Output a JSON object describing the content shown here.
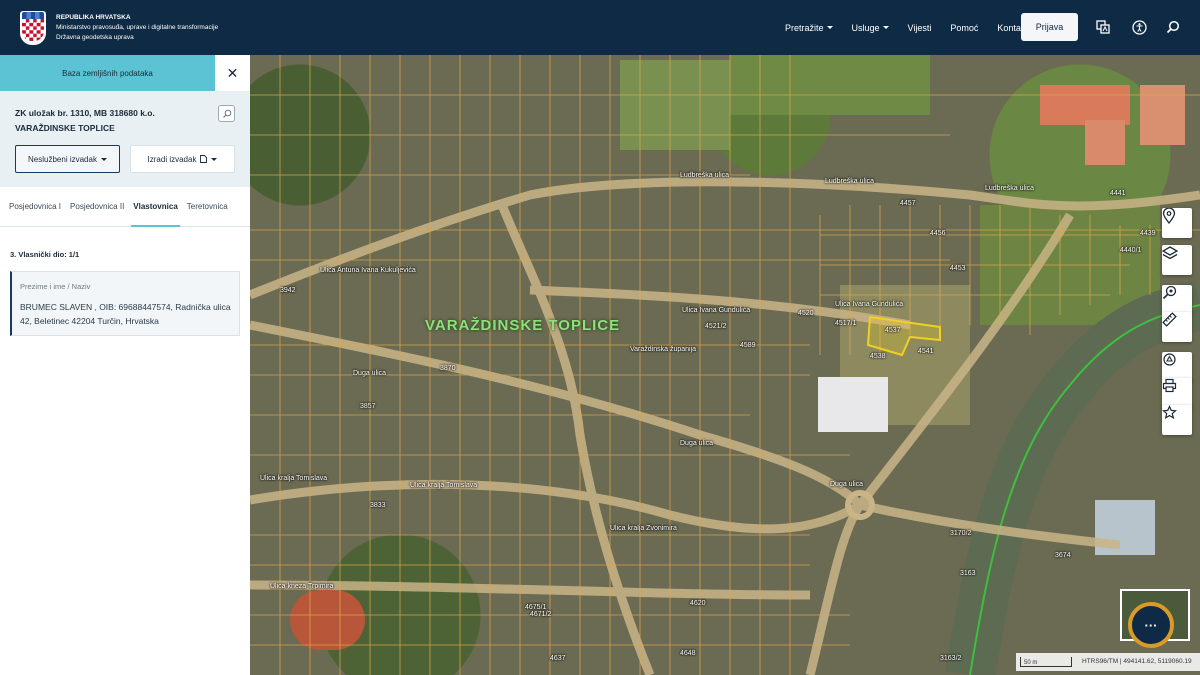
{
  "header": {
    "org_line1": "REPUBLIKA HRVATSKA",
    "org_line2": "Ministarstvo pravosuđa, uprave i digitalne transformacije",
    "org_line3": "Državna geodetska uprava",
    "nav": [
      "Pretražite",
      "Usluge",
      "Vijesti",
      "Pomoć",
      "Kontakt"
    ],
    "login": "Prijava"
  },
  "sidebar": {
    "title": "Baza zemljišnih podataka",
    "zk_title": "ZK uložak br. 1310, MB 318680 k.o.",
    "zk_municipality": "VARAŽDINSKE TOPLICE",
    "btn_unofficial": "Neslužbeni izvadak",
    "btn_create": "Izradi izvadak",
    "tabs": [
      "Posjedovnica I",
      "Posjedovnica II",
      "Vlastovnica",
      "Teretovnica"
    ],
    "active_tab": "Vlastovnica",
    "share_label": "3. Vlasnički dio: 1/1",
    "owner_label": "Prezime i ime / Naziv",
    "owner_value": "BRUMEC SLAVEN , OIB: 69688447574, Radnička ulica 42, Beletinec 42204 Turčin, Hrvatska"
  },
  "map": {
    "town": "VARAŽDINSKE TOPLICE",
    "streets": [
      "Ludbreška ulica",
      "Ludbreška ulica",
      "Ludbreška ulica",
      "Ulica Ivana Gundulića",
      "Ulica Ivana Gundulića",
      "Varaždinska županija",
      "Duga ulica",
      "Duga ulica",
      "Duga ulica",
      "Ulica kralja Tomislava",
      "Ulica kralja Tomislava",
      "Ulica kralja Zvonimira",
      "Ulica kneza Trpimira",
      "Ulica Antuna Ivana Kukuljevića"
    ],
    "parcels": [
      "4537",
      "4538",
      "4541",
      "4517/1",
      "4520",
      "4589",
      "4521/2",
      "4456",
      "4457",
      "4453",
      "4441",
      "4440/1",
      "4439",
      "3857",
      "3870",
      "4620",
      "4675/1",
      "4671/2",
      "4637",
      "4648",
      "3942",
      "3833",
      "3674",
      "3163",
      "3170/2",
      "3163/2"
    ],
    "scale": "50 m",
    "coords": "HTRS96/TM | 494141.62, 5119060.19"
  },
  "colors": {
    "header": "#0f2a44",
    "accent": "#5bc3d3",
    "parcel_line": "#e0a84a",
    "highlight": "#f0d020",
    "boundary": "#3fbf3f"
  },
  "icons": [
    "location-icon",
    "layers-icon",
    "zoom-search-icon",
    "ruler-icon",
    "share-icon",
    "print-icon",
    "star-icon",
    "translate-icon",
    "accessibility-icon",
    "search-icon",
    "close-icon",
    "chat-icon"
  ]
}
